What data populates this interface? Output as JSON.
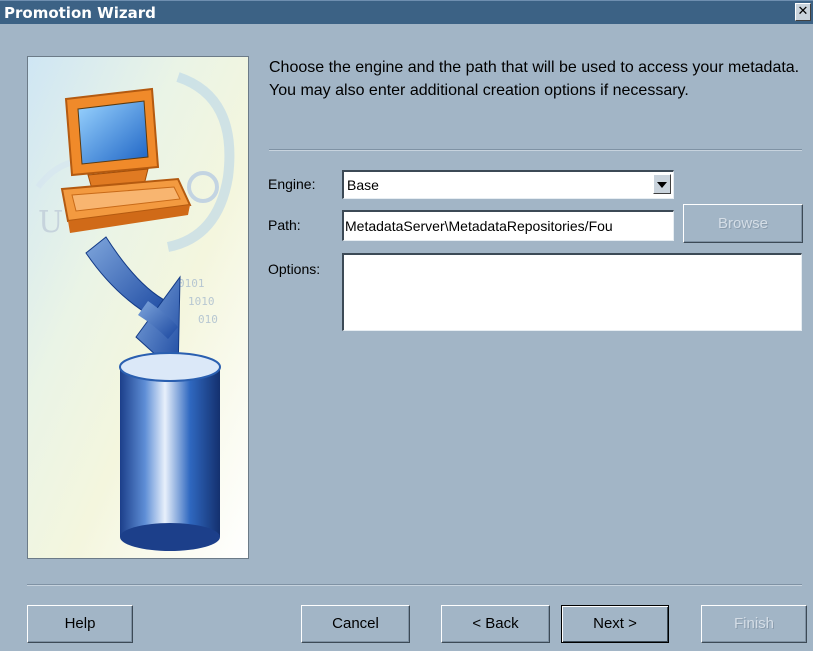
{
  "window": {
    "title": "Promotion Wizard",
    "close_glyph": "✕"
  },
  "intro": "Choose the engine and the path that will be used to access your metadata. You may also enter additional creation options if necessary.",
  "form": {
    "engine_label": "Engine:",
    "engine_value": "Base",
    "path_label": "Path:",
    "path_value": "MetadataServer\\MetadataRepositories/Fou",
    "browse_label": "Browse",
    "options_label": "Options:",
    "options_value": ""
  },
  "buttons": {
    "help": "Help",
    "cancel": "Cancel",
    "back": "< Back",
    "next": "Next >",
    "finish": "Finish"
  },
  "colors": {
    "dialog_bg": "#a2b5c6",
    "titlebar": "#3c6285",
    "monitor_orange": "#f08a2a",
    "cylinder_blue": "#2a5fb0"
  },
  "icons": [
    "computer-illustration",
    "arrow-illustration",
    "database-cylinder-illustration",
    "close-icon",
    "chevron-down-icon"
  ]
}
